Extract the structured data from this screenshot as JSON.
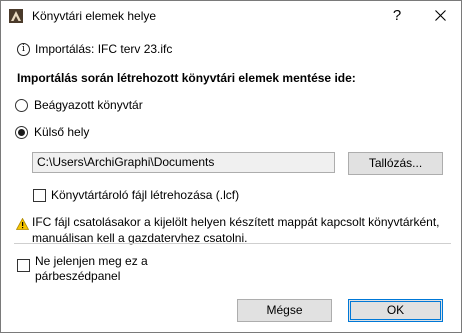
{
  "window": {
    "title": "Könyvtári elemek helye",
    "help_glyph": "?"
  },
  "info": {
    "text": "Importálás: IFC terv 23.ifc"
  },
  "section_label": "Importálás során létrehozott könyvtári elemek mentése ide:",
  "options": {
    "embedded": {
      "label": "Beágyazott könyvtár",
      "selected": false
    },
    "external": {
      "label": "Külső hely",
      "selected": true
    }
  },
  "path": {
    "value": "C:\\Users\\ArchiGraphi\\Documents"
  },
  "browse_label": "Tallózás...",
  "lcf_checkbox": {
    "label": "Könyvtártároló fájl létrehozása (.lcf)",
    "checked": false
  },
  "warning": {
    "line1": "IFC fájl csatolásakor a kijelölt helyen készített mappát kapcsolt könyvtárként,",
    "line2": "manuálisan kell a gazdatervhez csatolni."
  },
  "dont_show": {
    "line1": "Ne jelenjen meg ez a",
    "line2": "párbeszédpanel",
    "checked": false
  },
  "buttons": {
    "cancel": "Mégse",
    "ok": "OK"
  },
  "colors": {
    "accent": "#0078d7",
    "warning": "#f5c400"
  }
}
